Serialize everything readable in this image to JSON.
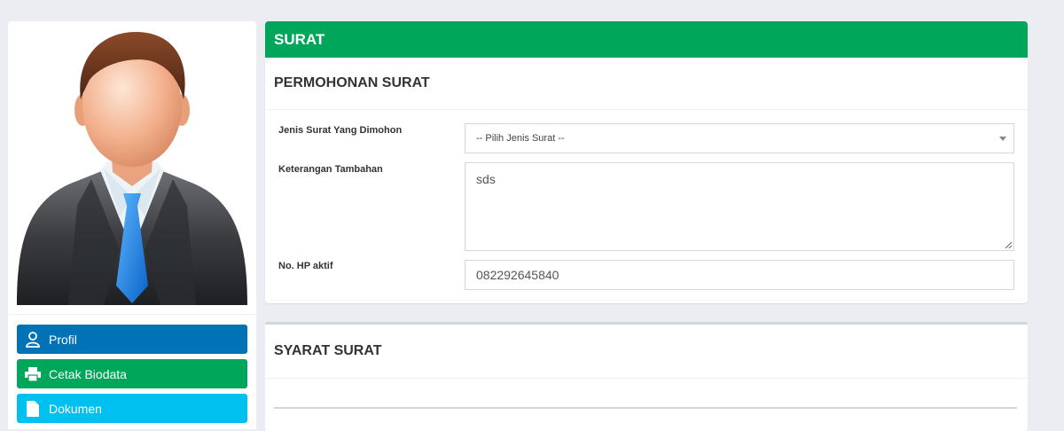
{
  "sidebar": {
    "menu": [
      {
        "label": "Profil",
        "icon": "user-icon",
        "color": "#0073b7"
      },
      {
        "label": "Cetak Biodata",
        "icon": "printer-icon",
        "color": "#00a65a"
      },
      {
        "label": "Dokumen",
        "icon": "file-icon",
        "color": "#00c0ef"
      }
    ]
  },
  "surat": {
    "header": "SURAT",
    "header_color": "#00a65a",
    "section_title": "PERMOHONAN SURAT",
    "jenis_label": "Jenis Surat Yang Dimohon",
    "jenis_value": "-- Pilih Jenis Surat --",
    "keterangan_label": "Keterangan Tambahan",
    "keterangan_value": "sds",
    "hp_label": "No. HP aktif",
    "hp_value": "082292645840"
  },
  "syarat": {
    "section_title": "SYARAT SURAT"
  }
}
